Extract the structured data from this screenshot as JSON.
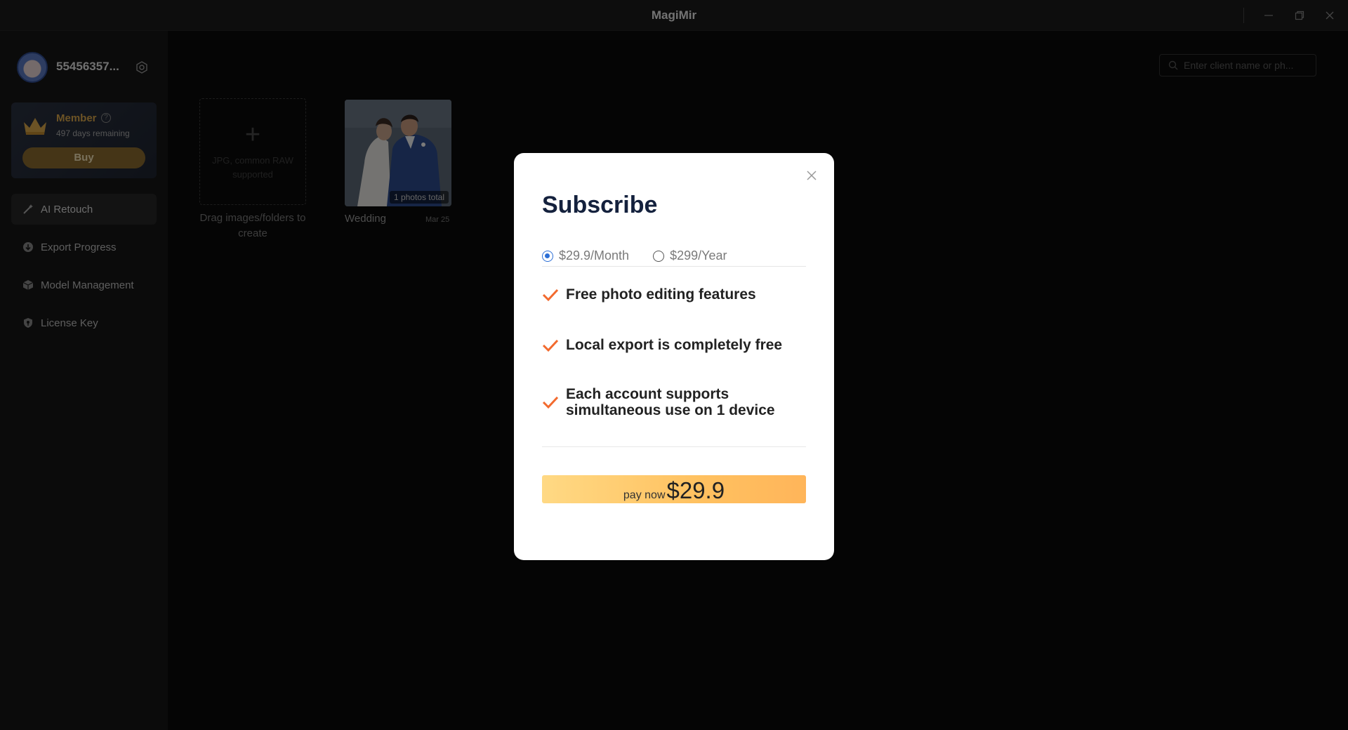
{
  "app": {
    "title": "MagiMir"
  },
  "user": {
    "name": "55456357..."
  },
  "membership": {
    "title": "Member",
    "days_remaining": "497 days remaining",
    "buy_label": "Buy"
  },
  "nav": [
    {
      "label": "AI Retouch",
      "icon": "magic-wand-icon",
      "active": true
    },
    {
      "label": "Export Progress",
      "icon": "download-circle-icon",
      "active": false
    },
    {
      "label": "Model Management",
      "icon": "cube-icon",
      "active": false
    },
    {
      "label": "License Key",
      "icon": "shield-key-icon",
      "active": false
    }
  ],
  "search": {
    "placeholder": "Enter client name or ph..."
  },
  "upload": {
    "hint": "JPG, common RAW supported",
    "caption": "Drag images/folders to create"
  },
  "album": {
    "name": "Wedding",
    "date": "Mar 25",
    "count": "1 photos total"
  },
  "modal": {
    "title": "Subscribe",
    "plans": [
      {
        "label": "$29.9/Month",
        "selected": true
      },
      {
        "label": "$299/Year",
        "selected": false
      }
    ],
    "features": [
      "Free photo editing features",
      "Local export is completely free",
      "Each account supports simultaneous use on 1 device"
    ],
    "pay_label": "pay now",
    "pay_amount": "$29.9"
  },
  "colors": {
    "accent_orange": "#f26a2e",
    "radio_blue": "#2c6fd6",
    "gold": "#d9a64a"
  }
}
